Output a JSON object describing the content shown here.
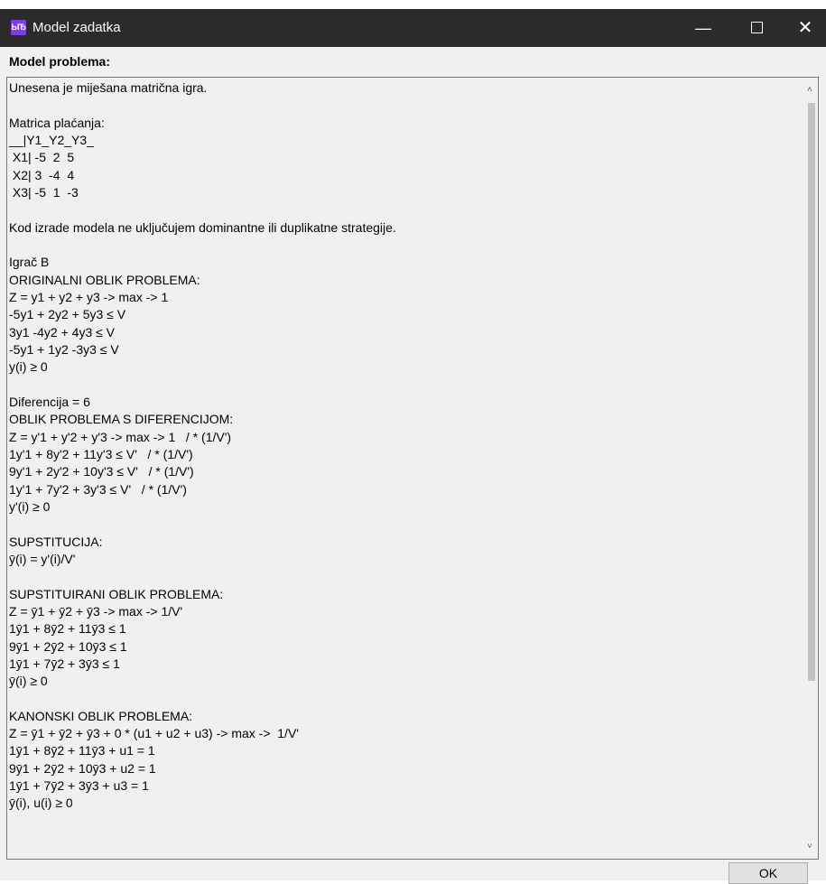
{
  "window": {
    "icon_text": "ЫЂ",
    "title": "Model zadatka",
    "minimize_glyph": "—",
    "close_glyph": "✕"
  },
  "section_label": "Model problema:",
  "textarea": {
    "text": "Unesena je miješana matrična igra.\n\nMatrica plaćanja:\n__|Y1_Y2_Y3_\n X1| -5  2  5\n X2| 3  -4  4\n X3| -5  1  -3\n\nKod izrade modela ne uključujem dominantne ili duplikatne strategije.\n\nIgrač B\nORIGINALNI OBLIK PROBLEMA:\nZ = y1 + y2 + y3 -> max -> 1\n-5y1 + 2y2 + 5y3 ≤ V\n3y1 -4y2 + 4y3 ≤ V\n-5y1 + 1y2 -3y3 ≤ V\ny(i) ≥ 0\n\nDiferencija = 6\nOBLIK PROBLEMA S DIFERENCIJOM:\nZ = y'1 + y'2 + y'3 -> max -> 1   / * (1/V')\n1y'1 + 8y'2 + 11y'3 ≤ V'   / * (1/V')\n9y'1 + 2y'2 + 10y'3 ≤ V'   / * (1/V')\n1y'1 + 7y'2 + 3y'3 ≤ V'   / * (1/V')\ny'(i) ≥ 0\n\nSUPSTITUCIJA:\nȳ(i) = y'(i)/V'\n\nSUPSTITUIRANI OBLIK PROBLEMA:\nZ = ȳ1 + ȳ2 + ȳ3 -> max -> 1/V'\n1ȳ1 + 8ȳ2 + 11ȳ3 ≤ 1\n9ȳ1 + 2ȳ2 + 10ȳ3 ≤ 1\n1ȳ1 + 7ȳ2 + 3ȳ3 ≤ 1\nȳ(i) ≥ 0\n\nKANONSKI OBLIK PROBLEMA:\nZ = ȳ1 + ȳ2 + ȳ3 + 0 * (u1 + u2 + u3) -> max ->  1/V'\n1ȳ1 + 8ȳ2 + 11ȳ3 + u1 = 1\n9ȳ1 + 2ȳ2 + 10ȳ3 + u2 = 1\n1ȳ1 + 7ȳ2 + 3ȳ3 + u3 = 1\nȳ(i), u(i) ≥ 0"
  },
  "scrollbar": {
    "up_arrow": "˄",
    "down_arrow": "˅"
  },
  "buttons": {
    "ok_label": "OK"
  }
}
